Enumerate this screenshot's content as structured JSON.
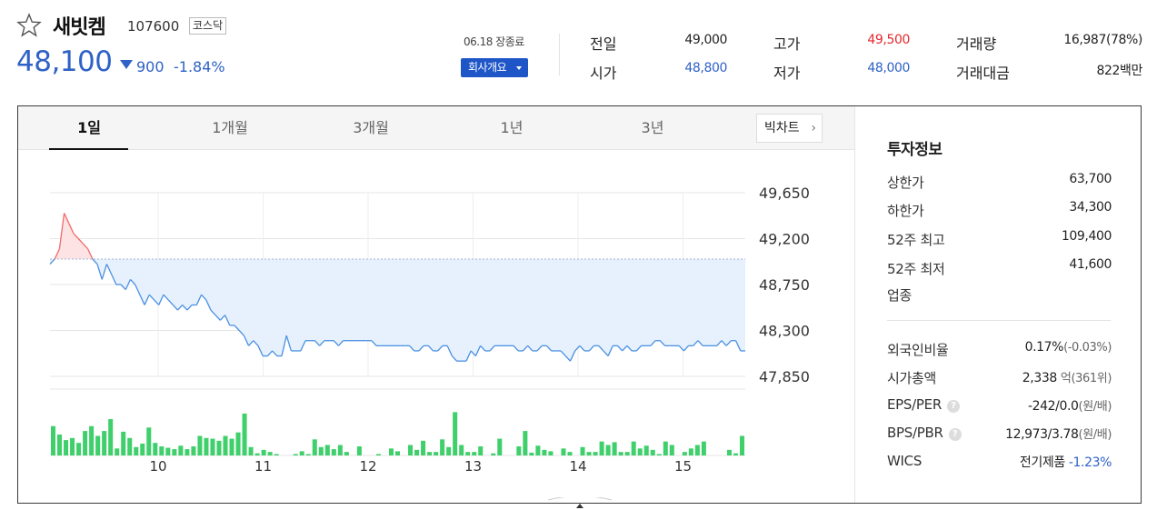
{
  "stock": {
    "name": "새빗켐",
    "code": "107600",
    "market": "코스닥",
    "price": "48,100",
    "change": "900",
    "change_direction": "down",
    "change_pct": "-1.84%",
    "date": "06.18 장종료",
    "company_button": "회사개요"
  },
  "quote": {
    "prev_close_label": "전일",
    "prev_close": "49,000",
    "open_label": "시가",
    "open": "48,800",
    "high_label": "고가",
    "high": "49,500",
    "low_label": "저가",
    "low": "48,000",
    "volume_label": "거래량",
    "volume": "16,987(78%)",
    "amount_label": "거래대금",
    "amount": "822백만"
  },
  "tabs": [
    "1일",
    "1개월",
    "3개월",
    "1년",
    "3년"
  ],
  "active_tab": "1일",
  "candle_button": "빅차트",
  "investment": {
    "title": "투자정보",
    "upper_limit_label": "상한가",
    "upper_limit": "63,700",
    "lower_limit_label": "하한가",
    "lower_limit": "34,300",
    "high52_label": "52주 최고",
    "high52": "109,400",
    "low52_label": "52주 최저",
    "low52": "41,600",
    "sector_label": "업종",
    "foreign_label": "외국인비율",
    "foreign": "0.17%",
    "foreign_sub": "(-0.03%)",
    "market_cap_label": "시가총액",
    "market_cap": "2,338",
    "market_cap_sub": "억(361위)",
    "eps_label": "EPS/PER",
    "eps": "-242/0.0",
    "eps_sub": "(원/배)",
    "bps_label": "BPS/PBR",
    "bps": "12,973/3.78",
    "bps_sub": "(원/배)",
    "wics_label": "WICS",
    "wics": "전기제품",
    "wics_pct": "-1.23%"
  },
  "colors": {
    "accent": "#2f62c6",
    "up": "#e3292e",
    "volume_bar": "#3fcf6b",
    "line": "#4a90e2",
    "fill": "#e6f1fd"
  },
  "chart_data": {
    "type": "line",
    "y_ticks": [
      "49,650",
      "49,200",
      "48,750",
      "48,300",
      "47,850"
    ],
    "ylim": [
      47850,
      49650
    ],
    "x_ticks": [
      "10",
      "11",
      "12",
      "13",
      "14",
      "15"
    ],
    "reference_price": 49000,
    "prices": [
      48950,
      49000,
      49100,
      49450,
      49350,
      49250,
      49200,
      49150,
      49100,
      49000,
      48950,
      48800,
      48950,
      48850,
      48750,
      48750,
      48700,
      48800,
      48750,
      48650,
      48550,
      48650,
      48600,
      48550,
      48650,
      48600,
      48550,
      48500,
      48550,
      48500,
      48550,
      48550,
      48650,
      48600,
      48500,
      48450,
      48400,
      48450,
      48350,
      48350,
      48300,
      48250,
      48150,
      48200,
      48150,
      48050,
      48050,
      48100,
      48050,
      48050,
      48250,
      48100,
      48100,
      48100,
      48200,
      48200,
      48200,
      48150,
      48200,
      48200,
      48200,
      48150,
      48200,
      48200,
      48200,
      48200,
      48200,
      48200,
      48200,
      48150,
      48150,
      48150,
      48150,
      48150,
      48150,
      48150,
      48150,
      48100,
      48100,
      48150,
      48150,
      48100,
      48100,
      48150,
      48150,
      48050,
      48000,
      48000,
      48000,
      48100,
      48050,
      48150,
      48100,
      48100,
      48150,
      48150,
      48150,
      48150,
      48150,
      48100,
      48100,
      48150,
      48100,
      48100,
      48150,
      48150,
      48100,
      48100,
      48100,
      48050,
      48000,
      48100,
      48150,
      48100,
      48100,
      48150,
      48150,
      48100,
      48050,
      48150,
      48150,
      48100,
      48150,
      48100,
      48100,
      48150,
      48150,
      48150,
      48200,
      48200,
      48150,
      48150,
      48150,
      48150,
      48100,
      48150,
      48150,
      48200,
      48150,
      48150,
      48150,
      48150,
      48200,
      48150,
      48200,
      48200,
      48100,
      48100
    ],
    "volumes": [
      42,
      30,
      22,
      25,
      18,
      35,
      42,
      28,
      35,
      52,
      10,
      34,
      25,
      12,
      17,
      40,
      18,
      13,
      11,
      9,
      14,
      9,
      13,
      28,
      25,
      24,
      21,
      28,
      24,
      33,
      60,
      12,
      3,
      8,
      5,
      2,
      0,
      0,
      2,
      6,
      2,
      23,
      12,
      15,
      9,
      15,
      5,
      0,
      13,
      0,
      0,
      2,
      0,
      10,
      6,
      0,
      15,
      8,
      21,
      5,
      5,
      23,
      12,
      62,
      15,
      5,
      5,
      13,
      0,
      3,
      24,
      0,
      0,
      13,
      35,
      4,
      14,
      8,
      6,
      0,
      10,
      5,
      0,
      12,
      5,
      5,
      20,
      15,
      19,
      5,
      5,
      20,
      10,
      14,
      8,
      2,
      20,
      15,
      0,
      5,
      10,
      15,
      20,
      0,
      0,
      0,
      8,
      3,
      28
    ],
    "volume_max": 95
  }
}
